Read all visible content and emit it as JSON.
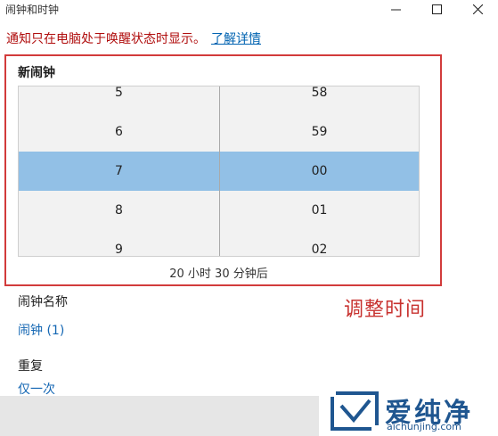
{
  "window": {
    "title": "闹钟和时钟"
  },
  "notice": {
    "text": "通知只在电脑处于唤醒状态时显示。",
    "link": "了解详情"
  },
  "picker": {
    "title": "新闹钟",
    "hours": [
      "5",
      "6",
      "7",
      "8",
      "9"
    ],
    "minutes": [
      "58",
      "59",
      "00",
      "01",
      "02"
    ],
    "selected_index": 2,
    "countdown": "20 小时 30 分钟后"
  },
  "annotation": "调整时间",
  "name": {
    "label": "闹钟名称",
    "value": "闹钟 (1)"
  },
  "repeat": {
    "label": "重复",
    "value": "仅一次"
  },
  "watermark": {
    "text": "爱纯净",
    "url": "aichunjing.com"
  },
  "colors": {
    "selection": "#92c0e6",
    "link": "#0063b1",
    "notice": "#b00d0d",
    "highlight_border": "#d23b3b"
  }
}
